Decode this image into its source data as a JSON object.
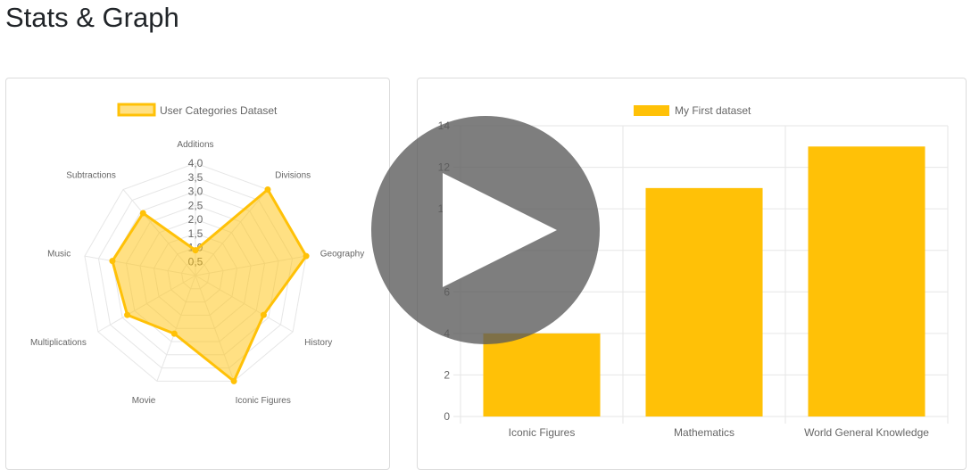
{
  "page": {
    "title": "Stats & Graph"
  },
  "colors": {
    "accent": "#FFC107",
    "accent_fill": "rgba(255,193,7,0.5)",
    "grid": "#e6e6e6",
    "text": "#666666",
    "overlay": "#5a5a5a"
  },
  "overlay": {
    "icon": "play-icon"
  },
  "chart_data": [
    {
      "type": "radar",
      "legend": "User Categories Dataset",
      "legend_position": "top",
      "categories": [
        "Additions",
        "Divisions",
        "Geography",
        "History",
        "Iconic Figures",
        "Movie",
        "Multiplications",
        "Music",
        "Subtractions"
      ],
      "values": [
        0.9,
        4.0,
        4.0,
        2.8,
        4.0,
        2.2,
        2.8,
        3.0,
        2.9
      ],
      "rlim": [
        0,
        4.0
      ],
      "ticks": [
        "0,5",
        "1,0",
        "1,5",
        "2,0",
        "2,5",
        "3,0",
        "3,5",
        "4,0"
      ],
      "grid": true
    },
    {
      "type": "bar",
      "legend": "My First dataset",
      "legend_position": "top",
      "categories": [
        "Iconic Figures",
        "Mathematics",
        "World General Knowledge"
      ],
      "values": [
        4,
        11,
        13
      ],
      "ylim": [
        0,
        14
      ],
      "yticks": [
        "0",
        "2",
        "4",
        "6",
        "8",
        "10",
        "12",
        "14"
      ],
      "grid": true
    }
  ]
}
